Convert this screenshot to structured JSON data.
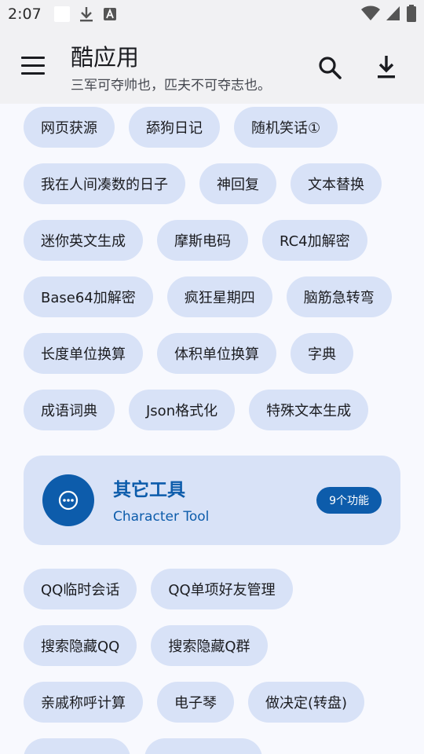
{
  "status_bar": {
    "time": "2:07"
  },
  "app_bar": {
    "title": "酷应用",
    "subtitle": "三军可夺帅也，匹夫不可夺志也。"
  },
  "chips_group1": [
    "网页获源",
    "舔狗日记",
    "随机笑话①",
    "我在人间凑数的日子",
    "神回复",
    "文本替换",
    "迷你英文生成",
    "摩斯电码",
    "RC4加解密",
    "Base64加解密",
    "疯狂星期四",
    "脑筋急转弯",
    "长度单位换算",
    "体积单位换算",
    "字典",
    "成语词典",
    "Json格式化",
    "特殊文本生成"
  ],
  "category_card": {
    "title": "其它工具",
    "subtitle": "Character Tool",
    "badge": "9个功能",
    "accent": "#0d5cab"
  },
  "chips_group2": [
    "QQ临时会话",
    "QQ单项好友管理",
    "搜索隐藏QQ",
    "搜索隐藏Q群",
    "亲戚称呼计算",
    "电子琴",
    "做决定(转盘)"
  ],
  "colors": {
    "chip_bg": "#d8e2f7",
    "accent": "#0d5cab",
    "background": "#f8f9fe"
  }
}
